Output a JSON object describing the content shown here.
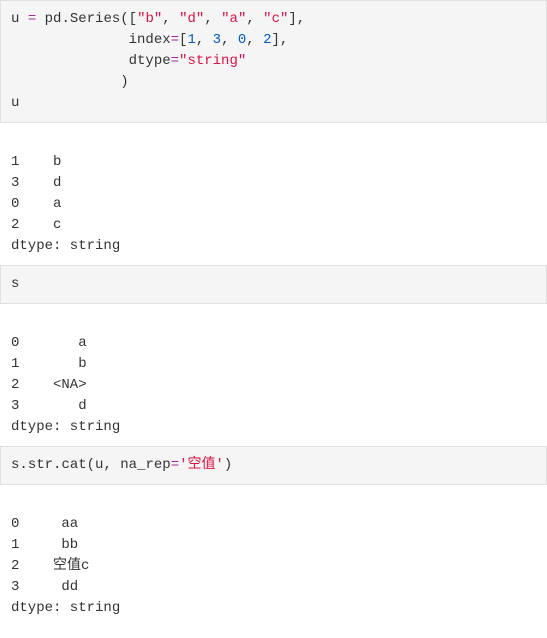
{
  "cell1": {
    "line1": {
      "a": "u ",
      "b": "=",
      "c": " pd",
      "d": ".",
      "e": "Series",
      "f": "([",
      "s1": "\"b\"",
      "c1": ", ",
      "s2": "\"d\"",
      "c2": ", ",
      "s3": "\"a\"",
      "c3": ", ",
      "s4": "\"c\"",
      "g": "],"
    },
    "line2": {
      "pad": "              ",
      "k": "index",
      "eq": "=",
      "br": "[",
      "n1": "1",
      "c1": ", ",
      "n2": "3",
      "c2": ", ",
      "n3": "0",
      "c3": ", ",
      "n4": "2",
      "close": "],"
    },
    "line3": {
      "pad": "              ",
      "k": "dtype",
      "eq": "=",
      "v": "\"string\""
    },
    "line4": {
      "pad": "             ",
      "close": ")"
    },
    "line5": "u"
  },
  "out1": "\n1    b\n3    d\n0    a\n2    c\ndtype: string",
  "cell2": "s",
  "out2": "\n0       a\n1       b\n2    <NA>\n3       d\ndtype: string",
  "cell3": {
    "a": "s",
    "b": ".",
    "c": "str",
    "d": ".",
    "e": "cat",
    "f": "(u, ",
    "k": "na_rep",
    "eq": "=",
    "s": "'空值'",
    "close": ")"
  },
  "out3": "\n0     aa\n1     bb\n2    空值c\n3     dd\ndtype: string"
}
